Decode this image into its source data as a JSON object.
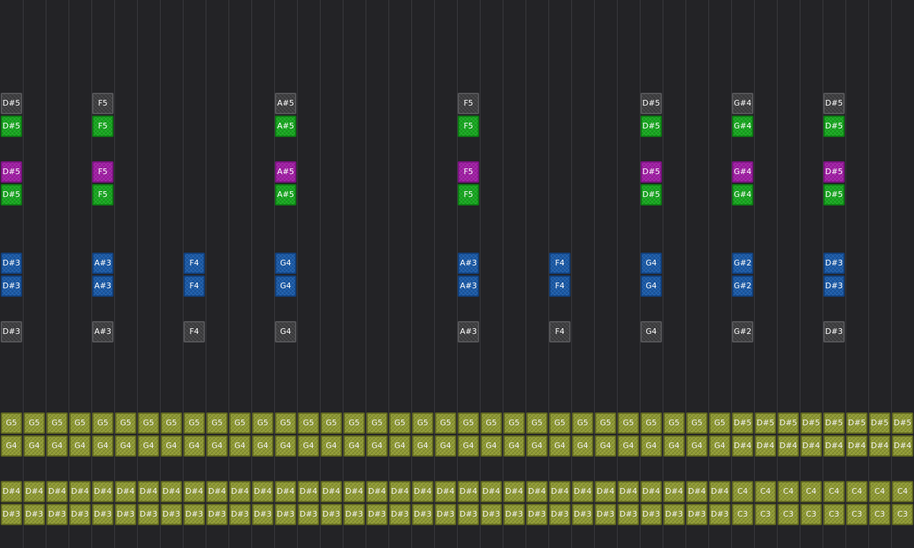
{
  "colors": {
    "background": "#232326",
    "grid_line": "#3a3a3e",
    "gray": "#3e3e40",
    "green": "#17a81f",
    "purple": "#a21ea6",
    "blue": "#1a5aa8",
    "olive": "#8f9a33"
  },
  "row_groups": [
    {
      "name": "row-a",
      "color": "gray",
      "notes": [
        [
          "0",
          "D#5"
        ],
        [
          "4",
          "F5"
        ],
        [
          "12",
          "A#5"
        ],
        [
          "20",
          "F5"
        ],
        [
          "28",
          "D#5"
        ],
        [
          "32",
          "G#4"
        ],
        [
          "36",
          "D#5"
        ]
      ]
    },
    {
      "name": "row-b",
      "color": "green",
      "notes": [
        [
          "0",
          "D#5"
        ],
        [
          "4",
          "F5"
        ],
        [
          "12",
          "A#5"
        ],
        [
          "20",
          "F5"
        ],
        [
          "28",
          "D#5"
        ],
        [
          "32",
          "G#4"
        ],
        [
          "36",
          "D#5"
        ]
      ]
    },
    {
      "name": "row-c",
      "color": "purple",
      "notes": [
        [
          "0",
          "D#5"
        ],
        [
          "4",
          "F5"
        ],
        [
          "12",
          "A#5"
        ],
        [
          "20",
          "F5"
        ],
        [
          "28",
          "D#5"
        ],
        [
          "32",
          "G#4"
        ],
        [
          "36",
          "D#5"
        ]
      ]
    },
    {
      "name": "row-d",
      "color": "green",
      "notes": [
        [
          "0",
          "D#5"
        ],
        [
          "4",
          "F5"
        ],
        [
          "12",
          "A#5"
        ],
        [
          "20",
          "F5"
        ],
        [
          "28",
          "D#5"
        ],
        [
          "32",
          "G#4"
        ],
        [
          "36",
          "D#5"
        ]
      ]
    },
    {
      "name": "row-e",
      "color": "blue",
      "notes": [
        [
          "0",
          "D#3"
        ],
        [
          "4",
          "A#3"
        ],
        [
          "8",
          "F4"
        ],
        [
          "12",
          "G4"
        ],
        [
          "20",
          "A#3"
        ],
        [
          "24",
          "F4"
        ],
        [
          "28",
          "G4"
        ],
        [
          "32",
          "G#2"
        ],
        [
          "36",
          "D#3"
        ]
      ]
    },
    {
      "name": "row-f",
      "color": "blue",
      "notes": [
        [
          "0",
          "D#3"
        ],
        [
          "4",
          "A#3"
        ],
        [
          "8",
          "F4"
        ],
        [
          "12",
          "G4"
        ],
        [
          "20",
          "A#3"
        ],
        [
          "24",
          "F4"
        ],
        [
          "28",
          "G4"
        ],
        [
          "32",
          "G#2"
        ],
        [
          "36",
          "D#3"
        ]
      ]
    },
    {
      "name": "row-g",
      "color": "gray",
      "notes": [
        [
          "0",
          "D#3"
        ],
        [
          "4",
          "A#3"
        ],
        [
          "8",
          "F4"
        ],
        [
          "12",
          "G4"
        ],
        [
          "20",
          "A#3"
        ],
        [
          "24",
          "F4"
        ],
        [
          "28",
          "G4"
        ],
        [
          "32",
          "G#2"
        ],
        [
          "36",
          "D#3"
        ]
      ]
    }
  ],
  "bass_rows": [
    {
      "name": "bass-row-1",
      "color": "olive",
      "labels": [
        "G5",
        "G5",
        "G5",
        "G5",
        "G5",
        "G5",
        "G5",
        "G5",
        "G5",
        "G5",
        "G5",
        "G5",
        "G5",
        "G5",
        "G5",
        "G5",
        "G5",
        "G5",
        "G5",
        "G5",
        "G5",
        "G5",
        "G5",
        "G5",
        "G5",
        "G5",
        "G5",
        "G5",
        "G5",
        "G5",
        "G5",
        "G5",
        "D#5",
        "D#5",
        "D#5",
        "D#5",
        "D#5",
        "D#5",
        "D#5",
        "D#5"
      ]
    },
    {
      "name": "bass-row-2",
      "color": "olive",
      "labels": [
        "G4",
        "G4",
        "G4",
        "G4",
        "G4",
        "G4",
        "G4",
        "G4",
        "G4",
        "G4",
        "G4",
        "G4",
        "G4",
        "G4",
        "G4",
        "G4",
        "G4",
        "G4",
        "G4",
        "G4",
        "G4",
        "G4",
        "G4",
        "G4",
        "G4",
        "G4",
        "G4",
        "G4",
        "G4",
        "G4",
        "G4",
        "G4",
        "D#4",
        "D#4",
        "D#4",
        "D#4",
        "D#4",
        "D#4",
        "D#4",
        "D#4"
      ]
    },
    {
      "name": "bass-row-3",
      "color": "olive",
      "labels": [
        "D#4",
        "D#4",
        "D#4",
        "D#4",
        "D#4",
        "D#4",
        "D#4",
        "D#4",
        "D#4",
        "D#4",
        "D#4",
        "D#4",
        "D#4",
        "D#4",
        "D#4",
        "D#4",
        "D#4",
        "D#4",
        "D#4",
        "D#4",
        "D#4",
        "D#4",
        "D#4",
        "D#4",
        "D#4",
        "D#4",
        "D#4",
        "D#4",
        "D#4",
        "D#4",
        "D#4",
        "D#4",
        "C4",
        "C4",
        "C4",
        "C4",
        "C4",
        "C4",
        "C4",
        "C4"
      ]
    },
    {
      "name": "bass-row-4",
      "color": "olive",
      "labels": [
        "D#3",
        "D#3",
        "D#3",
        "D#3",
        "D#3",
        "D#3",
        "D#3",
        "D#3",
        "D#3",
        "D#3",
        "D#3",
        "D#3",
        "D#3",
        "D#3",
        "D#3",
        "D#3",
        "D#3",
        "D#3",
        "D#3",
        "D#3",
        "D#3",
        "D#3",
        "D#3",
        "D#3",
        "D#3",
        "D#3",
        "D#3",
        "D#3",
        "D#3",
        "D#3",
        "D#3",
        "D#3",
        "C3",
        "C3",
        "C3",
        "C3",
        "C3",
        "C3",
        "C3",
        "C3"
      ]
    }
  ]
}
